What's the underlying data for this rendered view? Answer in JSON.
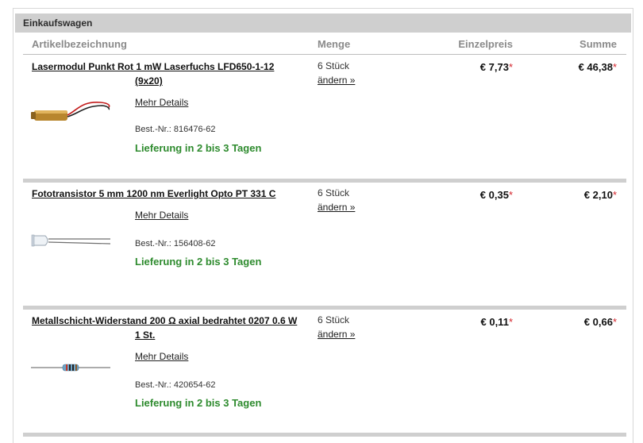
{
  "panel": {
    "title": "Einkaufswagen"
  },
  "columns": {
    "name": "Artikelbezeichnung",
    "qty": "Menge",
    "unit_price": "Einzelpreis",
    "sum": "Summe"
  },
  "items": [
    {
      "title_line1": "Lasermodul Punkt Rot 1 mW Laserfuchs LFD650-1-12",
      "title_line2": "(9x20)",
      "qty": "6 Stück",
      "change": "ändern »",
      "unit_price": "€ 7,73",
      "sum": "€ 46,38",
      "details": "Mehr Details",
      "artnr": "Best.-Nr.: 816476-62",
      "delivery": "Lieferung in 2 bis 3 Tagen",
      "icon": "laser-module-icon"
    },
    {
      "title_line1": "Fototransistor 5 mm 1200 nm Everlight Opto PT 331 C",
      "title_line2": "",
      "qty": "6 Stück",
      "change": "ändern »",
      "unit_price": "€ 0,35",
      "sum": "€ 2,10",
      "details": "Mehr Details",
      "artnr": "Best.-Nr.: 156408-62",
      "delivery": "Lieferung in 2 bis 3 Tagen",
      "icon": "phototransistor-icon"
    },
    {
      "title_line1": "Metallschicht-Widerstand 200 Ω axial bedrahtet 0207 0.6 W",
      "title_line2": "1 St.",
      "qty": "6 Stück",
      "change": "ändern »",
      "unit_price": "€ 0,11",
      "sum": "€ 0,66",
      "details": "Mehr Details",
      "artnr": "Best.-Nr.: 420654-62",
      "delivery": "Lieferung in 2 bis 3 Tagen",
      "icon": "resistor-icon"
    }
  ],
  "star": "*"
}
